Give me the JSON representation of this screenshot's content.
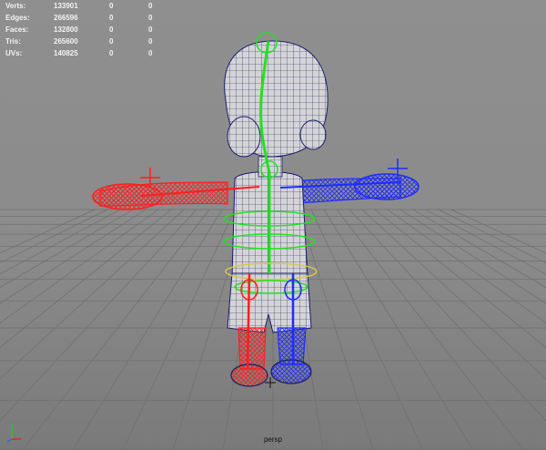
{
  "hud": {
    "rows": [
      {
        "label": "Verts:",
        "v1": "133901",
        "v2": "0",
        "v3": "0"
      },
      {
        "label": "Edges:",
        "v1": "266596",
        "v2": "0",
        "v3": "0"
      },
      {
        "label": "Faces:",
        "v1": "132800",
        "v2": "0",
        "v3": "0"
      },
      {
        "label": "Tris:",
        "v1": "265600",
        "v2": "0",
        "v3": "0"
      },
      {
        "label": "UVs:",
        "v1": "140825",
        "v2": "0",
        "v3": "0"
      }
    ]
  },
  "camera_label": "persp",
  "colors": {
    "viewport_bg": "#8e8e8e",
    "grid": "#6f6f6f",
    "mesh_fill": "#d4d4d6",
    "mesh_wire": "#1c1c66",
    "left_controls": "#ff1e1e",
    "right_controls": "#1e2cff",
    "center_controls": "#22e022",
    "hud_text": "#f2f2f2"
  },
  "axis_gizmo": {
    "x": "#d12c2c",
    "y": "#2cc22c",
    "z": "#2c6cd1"
  }
}
